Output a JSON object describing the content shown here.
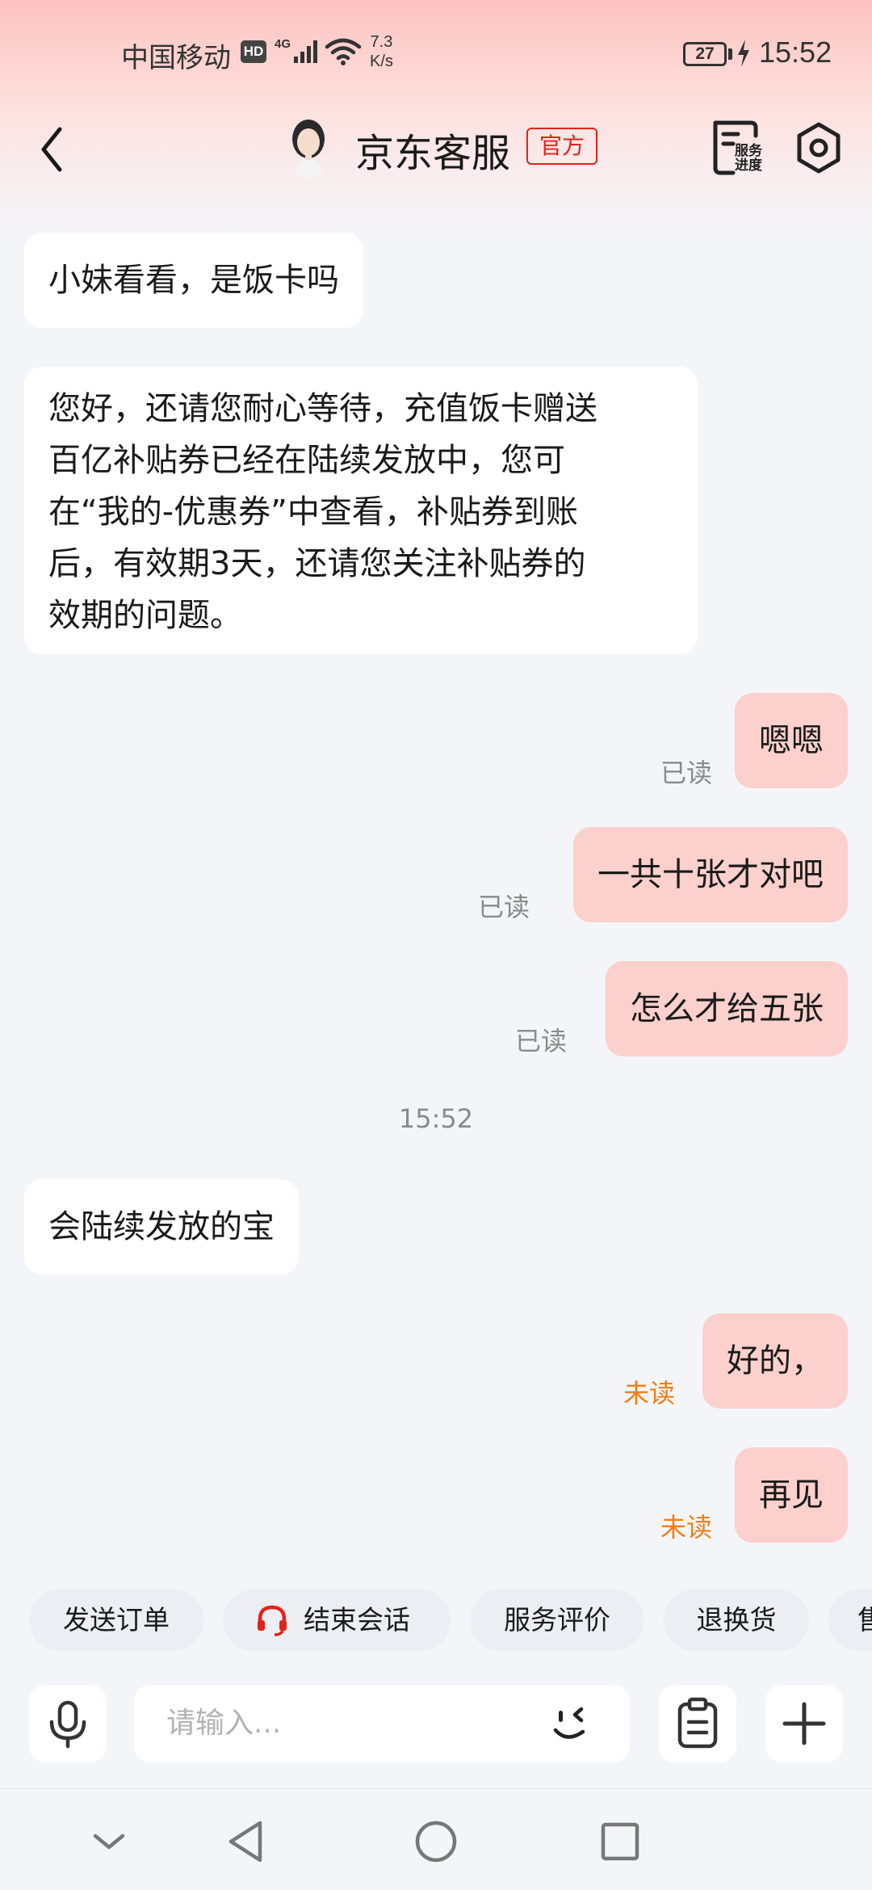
{
  "status_bar": {
    "carrier": "中国移动",
    "hd": "HD",
    "network": "4G",
    "speed_value": "7.3",
    "speed_unit": "K/s",
    "battery": "27",
    "time": "15:52"
  },
  "header": {
    "title": "京东客服",
    "badge": "官方",
    "service_progress_line1": "服务",
    "service_progress_line2": "进度"
  },
  "messages": [
    {
      "side": "left",
      "lines": [
        "小妹看看，是饭卡吗"
      ]
    },
    {
      "side": "left",
      "lines": [
        "您好，还请您耐心等待，充值饭卡赠送",
        "百亿补贴券已经在陆续发放中，您可",
        "在“我的-优惠券”中查看，补贴券到账",
        "后，有效期3天，还请您关注补贴券的",
        "效期的问题。"
      ]
    },
    {
      "side": "right",
      "lines": [
        "嗯嗯"
      ],
      "status": "已读"
    },
    {
      "side": "right",
      "lines": [
        "一共十张才对吧"
      ],
      "status": "已读"
    },
    {
      "side": "right",
      "lines": [
        "怎么才给五张"
      ],
      "status": "已读"
    },
    {
      "side": "left",
      "lines": [
        "会陆续发放的宝"
      ]
    },
    {
      "side": "right",
      "lines": [
        "好的，"
      ],
      "status": "未读"
    },
    {
      "side": "right",
      "lines": [
        "再见"
      ],
      "status": "未读"
    }
  ],
  "time_divider": "15:52",
  "quick_actions": [
    "发送订单",
    "结束会话",
    "服务评价",
    "退换货",
    "售"
  ],
  "input": {
    "placeholder": "请输入..."
  },
  "colors": {
    "brand_red": "#e2231a",
    "own_bubble": "#fbd0cd",
    "unread": "#f27d14",
    "read": "#8a8a8a"
  },
  "icons": [
    "back-icon",
    "service-progress-icon",
    "settings-icon",
    "headset-icon",
    "microphone-icon",
    "emoji-icon",
    "clipboard-icon",
    "plus-icon",
    "nav-down-icon",
    "nav-back-icon",
    "nav-home-icon",
    "nav-recents-icon"
  ]
}
